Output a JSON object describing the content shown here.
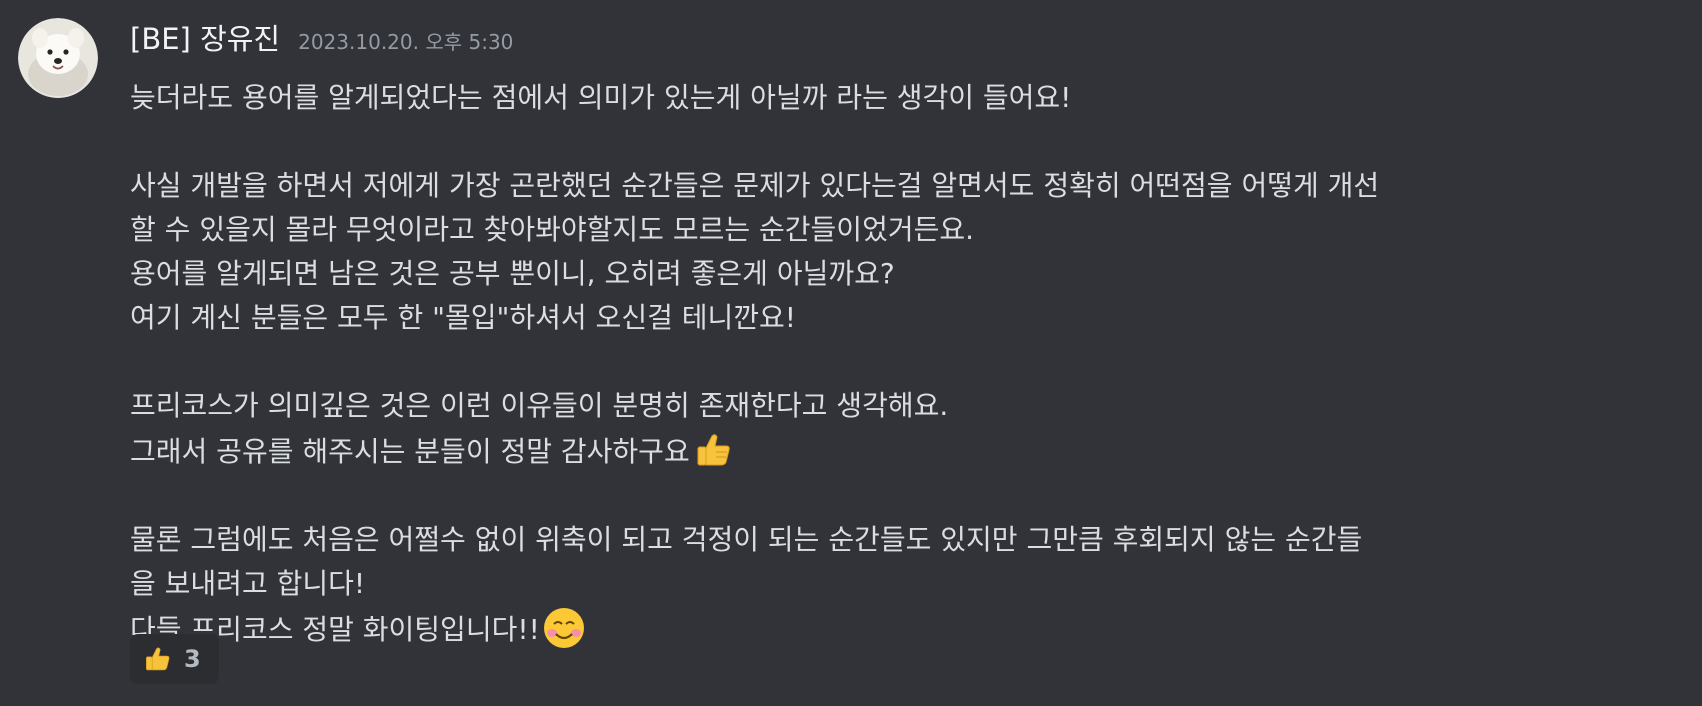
{
  "message": {
    "author": "[BE] 장유진",
    "timestamp": "2023.10.20. 오후 5:30",
    "lines": [
      "늦더라도 용어를 알게되었다는 점에서 의미가 있는게 아닐까 라는 생각이 들어요!",
      "",
      "사실 개발을 하면서 저에게 가장 곤란했던 순간들은 문제가 있다는걸 알면서도 정확히 어떤점을 어떻게 개선",
      "할 수 있을지 몰라 무엇이라고 찾아봐야할지도 모르는 순간들이었거든요.",
      "용어를 알게되면 남은 것은 공부 뿐이니, 오히려 좋은게 아닐까요?",
      "여기 계신 분들은 모두 한 \"몰입\"하셔서 오신걸 테니깐요!",
      "",
      "프리코스가 의미깊은 것은 이런 이유들이 분명히 존재한다고 생각해요.",
      "그래서 공유를 해주시는 분들이 정말 감사하구요",
      "",
      "물론 그럼에도 처음은 어쩔수 없이 위축이 되고 걱정이 되는 순간들도 있지만 그만큼 후회되지 않는 순간들",
      "을 보내려고 합니다!",
      "다들 프리코스 정말 화이팅입니다!!"
    ],
    "inline_emojis": {
      "line_8": "thumbs-up-emoji",
      "line_12": "smiling-blushing-emoji"
    }
  },
  "reaction": {
    "emoji": "thumbs-up-emoji",
    "count": "3"
  },
  "colors": {
    "background": "#313338",
    "username": "#f2f3f5",
    "timestamp": "#949ba4",
    "text": "#dbdee1",
    "reaction_bg": "#2b2d31"
  }
}
